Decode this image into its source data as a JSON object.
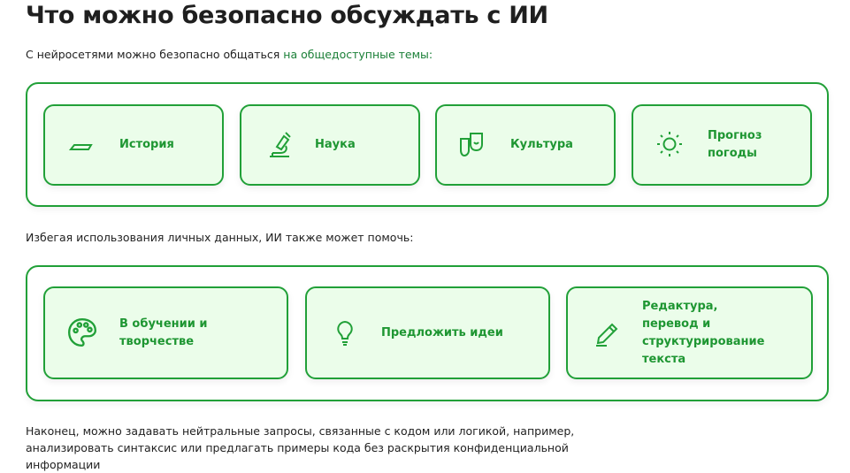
{
  "title": "Что можно безопасно обсуждать с ИИ",
  "intro": {
    "text": "С нейросетями можно безопасно общаться ",
    "link": "на общедоступные темы:"
  },
  "topics": [
    {
      "label": "История",
      "icon": "book-icon"
    },
    {
      "label": "Наука",
      "icon": "microscope-icon"
    },
    {
      "label": "Культура",
      "icon": "theater-masks-icon"
    },
    {
      "label": "Прогноз погоды",
      "icon": "sun-icon"
    }
  ],
  "help_intro": "Избегая использования личных данных, ИИ также может помочь:",
  "help": [
    {
      "label": "В обучении и творчестве",
      "icon": "palette-icon"
    },
    {
      "label": "Предложить идеи",
      "icon": "lightbulb-icon"
    },
    {
      "label": "Редактура, перевод и структурирование текста",
      "icon": "pencil-icon"
    }
  ],
  "outro": "Наконец, можно задавать нейтральные запросы, связанные с кодом или логикой, например, анализировать синтаксис или предлагать примеры кода без раскрытия конфиденциальной информации",
  "colors": {
    "accent": "#21a038",
    "card_bg": "#ebfdea"
  }
}
